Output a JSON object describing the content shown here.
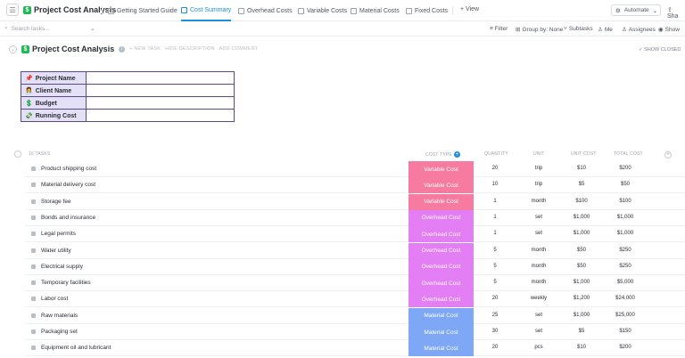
{
  "header": {
    "home_icon": "list-icon",
    "title": "Project Cost Analysis",
    "tabs": [
      {
        "label": "Getting Started Guide",
        "active": false
      },
      {
        "label": "Cost Summary",
        "active": true
      },
      {
        "label": "Overhead Costs",
        "active": false
      },
      {
        "label": "Variable Costs",
        "active": false
      },
      {
        "label": "Material Costs",
        "active": false
      },
      {
        "label": "Fixed Costs",
        "active": false
      }
    ],
    "add_view": "+ View",
    "automate": "Automate",
    "share": "Sha"
  },
  "toolbar": {
    "search_placeholder": "Search tasks...",
    "filter": "Filter",
    "group_by": "Group by: None",
    "subtasks": "Subtasks",
    "me": "Me",
    "assignees": "Assignees",
    "show": "Show"
  },
  "list": {
    "title": "Project Cost Analysis",
    "new_task": "+ NEW TASK",
    "hide_description": "HIDE DESCRIPTION",
    "add_comment": "ADD COMMENT",
    "show_closed": "SHOW CLOSED"
  },
  "info_table": [
    {
      "emoji": "📌",
      "label": "Project Name",
      "value": ""
    },
    {
      "emoji": "👩‍💼",
      "label": "Client Name",
      "value": ""
    },
    {
      "emoji": "💲",
      "label": "Budget",
      "value": ""
    },
    {
      "emoji": "💸",
      "label": "Running Cost",
      "value": ""
    }
  ],
  "columns": {
    "tasks": "16 TASKS",
    "cost_type": "COST TYPE",
    "quantity": "QUANTITY",
    "unit": "UNIT",
    "unit_cost": "UNIT COST",
    "total_cost": "TOTAL COST"
  },
  "colors": {
    "Variable Cost": "#f77ba1",
    "Overhead Cost": "#e47ef5",
    "Material Cost": "#7ea8f5",
    "accent": "#1a8fe0"
  },
  "rows": [
    {
      "name": "Product shipping cost",
      "type": "Variable Cost",
      "qty": "20",
      "unit": "trip",
      "unit_cost": "$10",
      "total": "$200"
    },
    {
      "name": "Material delivery cost",
      "type": "Variable Cost",
      "qty": "10",
      "unit": "trip",
      "unit_cost": "$5",
      "total": "$50"
    },
    {
      "name": "Storage fee",
      "type": "Variable Cost",
      "qty": "1",
      "unit": "month",
      "unit_cost": "$100",
      "total": "$100"
    },
    {
      "name": "Bonds and insurance",
      "type": "Overhead Cost",
      "qty": "1",
      "unit": "set",
      "unit_cost": "$1,000",
      "total": "$1,000"
    },
    {
      "name": "Legal permits",
      "type": "Overhead Cost",
      "qty": "1",
      "unit": "set",
      "unit_cost": "$1,000",
      "total": "$1,000"
    },
    {
      "name": "Water utility",
      "type": "Overhead Cost",
      "qty": "5",
      "unit": "month",
      "unit_cost": "$50",
      "total": "$250"
    },
    {
      "name": "Electrical supply",
      "type": "Overhead Cost",
      "qty": "5",
      "unit": "month",
      "unit_cost": "$50",
      "total": "$250"
    },
    {
      "name": "Temporary facilities",
      "type": "Overhead Cost",
      "qty": "5",
      "unit": "month",
      "unit_cost": "$1,000",
      "total": "$5,000"
    },
    {
      "name": "Labor cost",
      "type": "Overhead Cost",
      "qty": "20",
      "unit": "weekly",
      "unit_cost": "$1,200",
      "total": "$24,000"
    },
    {
      "name": "Raw materials",
      "type": "Material Cost",
      "qty": "25",
      "unit": "set",
      "unit_cost": "$1,000",
      "total": "$25,000"
    },
    {
      "name": "Packaging set",
      "type": "Material Cost",
      "qty": "30",
      "unit": "set",
      "unit_cost": "$5",
      "total": "$150"
    },
    {
      "name": "Equipment oil and lubricant",
      "type": "Material Cost",
      "qty": "20",
      "unit": "pcs",
      "unit_cost": "$10",
      "total": "$200"
    }
  ]
}
